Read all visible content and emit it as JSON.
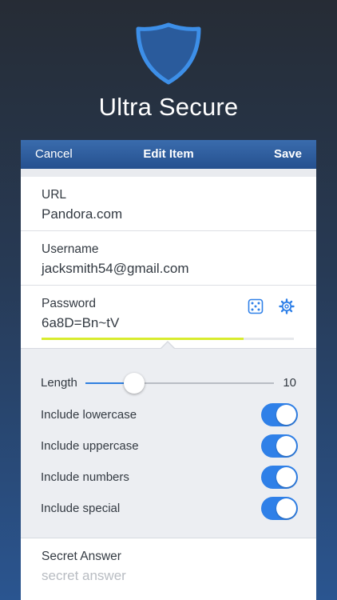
{
  "app": {
    "title": "Ultra Secure",
    "accent_color": "#2f80e8",
    "shield_color": "#3d8fe8"
  },
  "navbar": {
    "cancel_label": "Cancel",
    "title": "Edit Item",
    "save_label": "Save"
  },
  "fields": {
    "url": {
      "label": "URL",
      "value": "Pandora.com"
    },
    "username": {
      "label": "Username",
      "value": "jacksmith54@gmail.com"
    },
    "password": {
      "label": "Password",
      "value": "6a8D=Bn~tV",
      "strength": 0.8,
      "strength_color": "#d8ec2e"
    },
    "secret_answer": {
      "label": "Secret Answer",
      "placeholder": "secret answer"
    }
  },
  "password_icons": [
    "dice-icon",
    "gear-icon"
  ],
  "generator": {
    "length_label": "Length",
    "length_value": "10",
    "length_fraction": 0.26,
    "options": [
      {
        "label": "Include lowercase",
        "on": true
      },
      {
        "label": "Include uppercase",
        "on": true
      },
      {
        "label": "Include numbers",
        "on": true
      },
      {
        "label": "Include special",
        "on": true
      }
    ]
  }
}
